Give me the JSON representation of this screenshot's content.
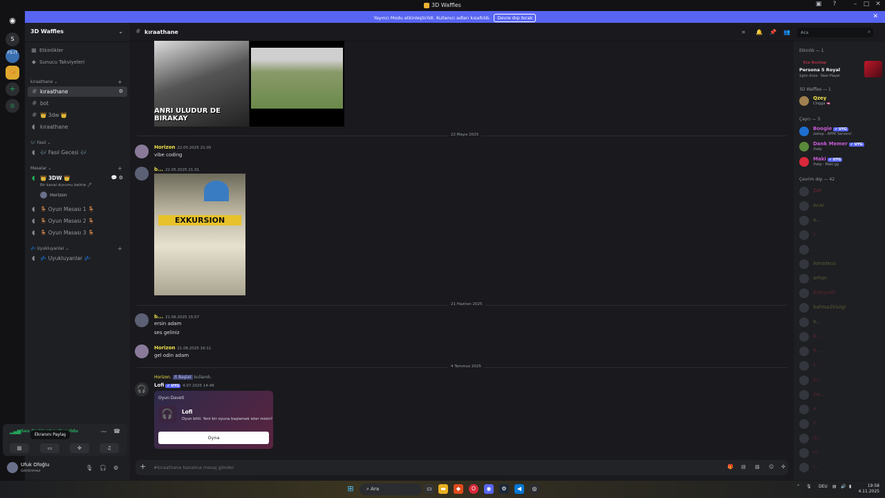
{
  "window": {
    "title": "3D Waffles"
  },
  "banner": {
    "text": "Yayıncı Modu etkinleştirildi. Kullanıcı adları kısaltıldı.",
    "button": "Devre dışı bırak"
  },
  "guilds": [
    {
      "label": "S"
    },
    {
      "label": "FS IT"
    }
  ],
  "server": {
    "name": "3D Waffles"
  },
  "sidebar": {
    "top_items": [
      {
        "label": "Etkinlikler"
      },
      {
        "label": "Sunucu Takviyeleri"
      }
    ],
    "categories": [
      {
        "name": "kıraathane"
      },
      {
        "name": "Fasıl"
      },
      {
        "name": "Masalar"
      },
      {
        "name": "Uyukluyanlar"
      }
    ],
    "channels": {
      "kiraathane": "kıraathane",
      "bot": "bot",
      "c3dw": "👑 3dw 👑",
      "kiraathane_voice": "kıraathane",
      "fasil_gecesi": "🎶 Fasıl Gecesi 🎶",
      "voice_3dw": "👑 3DW 👑",
      "status_hint": "Bir kanal durumu belirle 🖊",
      "voice_user": "Horizon",
      "masa1": "🪑 Oyun Masası 1 🪑",
      "masa2": "🪑 Oyun Masası 2 🪑",
      "masa3": "🪑 Oyun Masası 3 🪑",
      "uyukluyanlar": "💤 Uyukluyanlar 💤"
    }
  },
  "voice_panel": {
    "status": "Ses Bağlantısı Kuruldu",
    "tooltip": "Ekranını Paylaş"
  },
  "user": {
    "name": "Ufuk Ofoğlu",
    "status": "Görünmez"
  },
  "channel_header": {
    "name": "kıraathane",
    "search_placeholder": "Ara"
  },
  "messages": {
    "image_caption": "ANRI ULUDUR DE BIRAKAY",
    "divider1": "22 Mayıs 2025",
    "m1_author": "Horizon",
    "m1_time": "22.05.2025 21:05",
    "m1_text": "vibe coding",
    "m2_author": "b...",
    "m2_time": "22.05.2025 21:31",
    "image2_caption": "EXKURSION",
    "divider2": "21 Haziran 2025",
    "m3_author": "b...",
    "m3_time": "21.06.2025 15:57",
    "m3_text1": "ersin adam",
    "m3_text2": "ses geliniz",
    "m4_author": "Horizon",
    "m4_time": "21.06.2025 16:11",
    "m4_text": "gel odin adam",
    "divider3": "4 Temmuz 2025",
    "cmd_user": "Horizon",
    "cmd_name": "/t Başlat",
    "cmd_suffix": "kullandı.",
    "m5_author": "Lofi",
    "m5_tag": "✔ UYG",
    "m5_time": "4.07.2025 14:46",
    "invite_header": "Oyun Daveti",
    "invite_title": "Lofi",
    "invite_desc": "Oyun bitti. Yeni bir oyuna başlamak ister misin?",
    "invite_button": "Oyna"
  },
  "composer": {
    "placeholder": "#kıraathane kanalına mesaj gönder"
  },
  "members": {
    "cat_activity": "Etkinlik — 1",
    "activity": {
      "app": "Ece Rocklap",
      "game": "Persona 5 Royal",
      "meta": "1gün önce · New Player"
    },
    "cat_3d": "3D Waffles — 1",
    "qzey": {
      "name": "Qzey",
      "status": "Chigga 🫦"
    },
    "cat_player": "Çaycı — 3",
    "boogie": {
      "name": "Boogie",
      "tag": "✔ UYG",
      "status": "/setup - RPPK Servers!"
    },
    "dank": {
      "name": "Dank Memer",
      "tag": "✔ UYG",
      "status": "/help"
    },
    "maki": {
      "name": "Maki",
      "tag": "✔ UYG",
      "status": "/help - Maki.gg"
    },
    "cat_offline": "Çevrim dışı — 42",
    "offline": [
      "Zef",
      "AcAr",
      "a...",
      "s...",
      "...",
      "Amadeus",
      "arhan",
      "Bakiyedb",
      "bahtsa2kluigi",
      "b...",
      "B...",
      "R...",
      "C...",
      "D...",
      "Da...",
      "e...",
      "F...",
      "G...",
      "H...",
      "I..."
    ]
  },
  "taskbar": {
    "search": "Ara",
    "lang": "DEU",
    "time": "19:58",
    "date": "4.11.2025"
  },
  "colors": {
    "accent": "#5865f2",
    "online": "#23a55a",
    "bg": "#1a1a1e"
  }
}
